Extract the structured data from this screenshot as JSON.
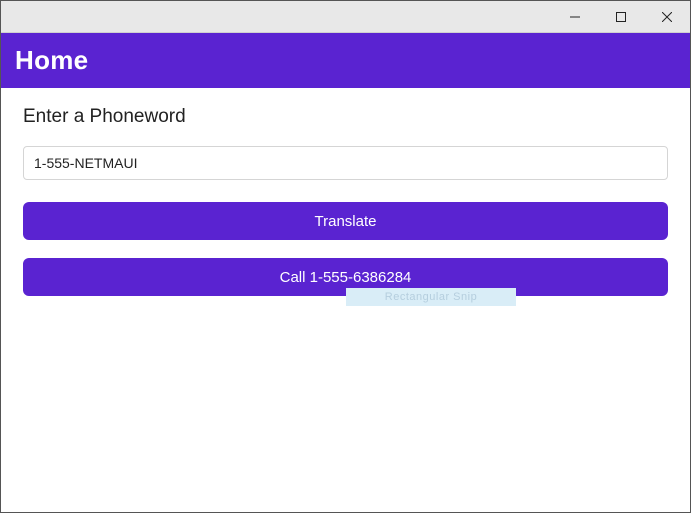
{
  "titlebar": {
    "minimize_label": "Minimize",
    "restore_label": "Restore",
    "close_label": "Close"
  },
  "header": {
    "title": "Home"
  },
  "main": {
    "label": "Enter a Phoneword",
    "input_value": "1-555-NETMAUI",
    "translate_label": "Translate",
    "call_label": "Call 1-555-6386284"
  },
  "overlay": {
    "snip_label": "Rectangular Snip"
  },
  "colors": {
    "accent": "#5a23d1"
  }
}
